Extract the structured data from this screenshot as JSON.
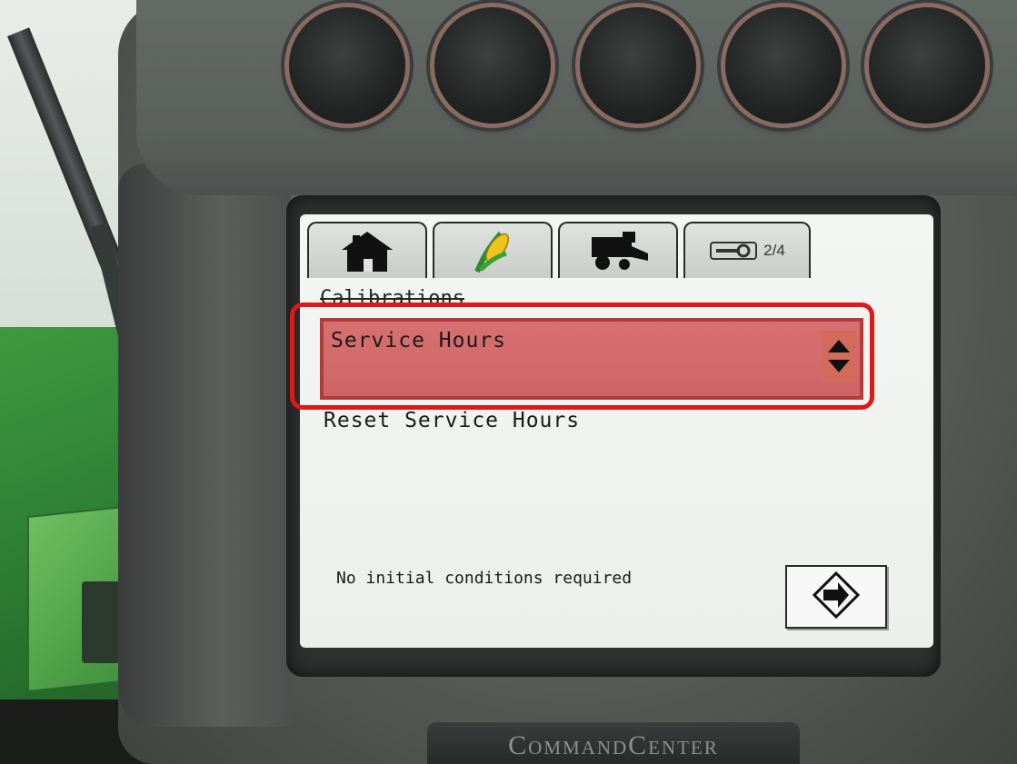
{
  "device": {
    "brand": "CommandCenter"
  },
  "tabs": [
    {
      "icon": "home-icon",
      "label": ""
    },
    {
      "icon": "corn-icon",
      "label": ""
    },
    {
      "icon": "combine-icon",
      "label": ""
    },
    {
      "icon": "wrench-icon",
      "label": "2/4"
    }
  ],
  "screen": {
    "heading": "Calibrations",
    "selected_item": "Service Hours",
    "menu_item": "Reset Service Hours",
    "status": "No initial conditions required"
  },
  "colors": {
    "highlight_outline": "#e01818",
    "selected_row": "#cf6466",
    "lcd_background": "#f0f2f0"
  }
}
